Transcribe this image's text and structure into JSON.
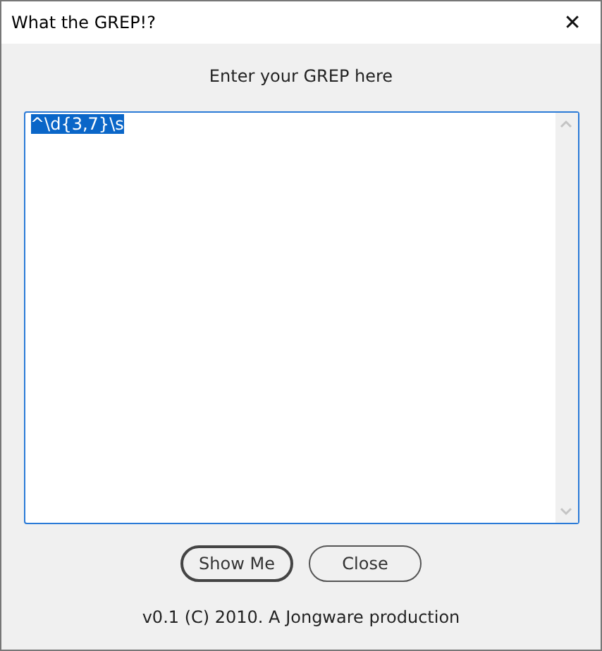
{
  "window": {
    "title": "What the GREP!?",
    "close_glyph": "✕"
  },
  "prompt": "Enter your GREP here",
  "grep_field": {
    "value": "^\\d{3,7}\\s",
    "selected": true
  },
  "buttons": [
    {
      "label": "Show Me",
      "default": true
    },
    {
      "label": "Close",
      "default": false
    }
  ],
  "footer": "v0.1 (C) 2010. A Jongware production"
}
